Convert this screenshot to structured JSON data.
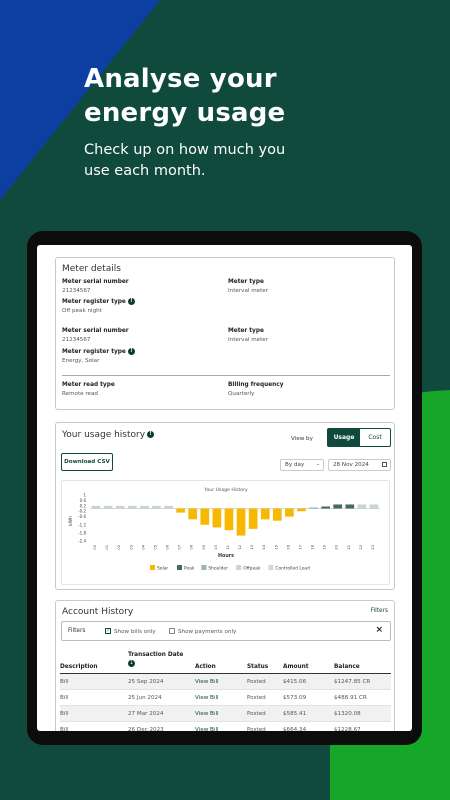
{
  "hero": {
    "title": "Analyse your energy usage",
    "subtitle": "Check up on how much you use each month."
  },
  "colors": {
    "brand_dark": "#0f4a3c",
    "blue": "#0d3fa3",
    "green": "#15a62a",
    "solar": "#f6b800",
    "shoulder": "#9fb5ad",
    "offpeak": "#c7d6d1",
    "peak": "#466b5f"
  },
  "meter_details": {
    "title": "Meter details",
    "serial_label": "Meter serial number",
    "type_label": "Meter type",
    "register_label": "Meter register type",
    "meters": [
      {
        "serial": "21234567",
        "type": "Interval meter",
        "register": "Off peak night"
      },
      {
        "serial": "21234567",
        "type": "Interval meter",
        "register": "Energy, Solar"
      }
    ],
    "read_type_label": "Meter read type",
    "read_type": "Remote read",
    "billing_label": "Billing frequency",
    "billing": "Quarterly"
  },
  "usage": {
    "title": "Your usage history",
    "view_by": "View by",
    "tab_usage": "Usage",
    "tab_cost": "Cost",
    "download": "Download CSV",
    "period": "By day",
    "date": "28 Nov 2024"
  },
  "chart_data": {
    "type": "bar",
    "title": "Your Usage History",
    "xlabel": "Hours",
    "ylabel": "kWh",
    "ylim": [
      -2.4,
      1
    ],
    "yticks": [
      "1",
      "0.6",
      "0.2",
      "-0.2",
      "-0.6",
      "-1.2",
      "-1.8",
      "-2.4"
    ],
    "categories": [
      "00",
      "01",
      "02",
      "03",
      "04",
      "05",
      "06",
      "07",
      "08",
      "09",
      "10",
      "11",
      "12",
      "13",
      "14",
      "15",
      "16",
      "17",
      "18",
      "19",
      "20",
      "21",
      "22",
      "23"
    ],
    "series": [
      {
        "name": "Solar",
        "values": [
          0,
          0,
          0,
          0,
          0,
          0,
          0,
          -0.3,
          -0.8,
          -1.2,
          -1.4,
          -1.6,
          -2.0,
          -1.5,
          -0.8,
          -0.9,
          -0.6,
          -0.2,
          0,
          0,
          0,
          0,
          0,
          0
        ]
      },
      {
        "name": "Peak",
        "values": [
          0,
          0,
          0,
          0,
          0,
          0,
          0,
          0,
          0,
          0,
          0,
          0,
          0,
          0,
          0,
          0,
          0,
          0,
          0,
          0.15,
          0.3,
          0.3,
          0,
          0
        ]
      },
      {
        "name": "Shoulder",
        "values": [
          0,
          0,
          0,
          0,
          0,
          0,
          0,
          0,
          0,
          0,
          0,
          0,
          0,
          0,
          0,
          0,
          0,
          0,
          0.08,
          0,
          0,
          0,
          0,
          0
        ]
      },
      {
        "name": "Offpeak",
        "values": [
          0.2,
          0.2,
          0.2,
          0.2,
          0.2,
          0.2,
          0.2,
          0,
          0,
          0,
          0,
          0,
          0,
          0,
          0,
          0,
          0,
          0,
          0,
          0,
          0,
          0,
          0.3,
          0.3
        ]
      },
      {
        "name": "Controlled Load",
        "values": [
          0,
          0,
          0,
          0,
          0,
          0,
          0,
          0,
          0,
          0,
          0,
          0,
          0,
          0,
          0,
          0,
          0,
          0,
          0,
          0,
          0,
          0,
          0,
          0
        ]
      }
    ]
  },
  "account": {
    "title": "Account History",
    "filters_link": "Filters",
    "filters_label": "Filters",
    "show_bills": "Show bills only",
    "show_payments": "Show payments only",
    "columns": [
      "Description",
      "Transaction Date",
      "Action",
      "Status",
      "Amount",
      "Balance"
    ],
    "rows": [
      [
        "Bill",
        "25 Sep 2024",
        "View Bill",
        "Posted",
        "$415.06",
        "$1247.85 CR"
      ],
      [
        "Bill",
        "25 Jun 2024",
        "View Bill",
        "Posted",
        "$573.09",
        "$488.91 CR"
      ],
      [
        "Bill",
        "27 Mar 2024",
        "View Bill",
        "Posted",
        "$585.41",
        "$1320.08"
      ],
      [
        "Bill",
        "26 Dec 2023",
        "View Bill",
        "Posted",
        "$664.34",
        "$1228.67"
      ]
    ]
  }
}
